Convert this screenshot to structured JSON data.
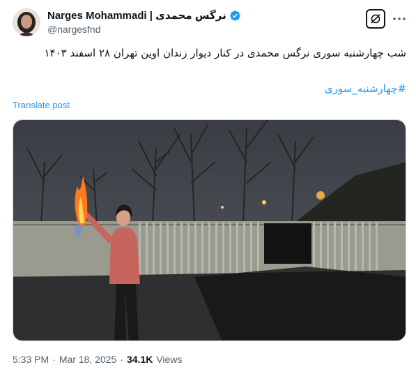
{
  "author": {
    "display_name": "Narges Mohammadi | نرگس محمدی",
    "handle": "@nargesfnd",
    "verified": true,
    "verified_color": "#1d9bf0"
  },
  "post": {
    "text": "شب چهارشنبه سوری نرگس محمدی در کنار دیوار زندان اوین تهران ۲۸ اسفند ۱۴۰۳",
    "hashtag": "#چهارشنبه_سوری",
    "translate_label": "Translate post"
  },
  "media": {
    "description_icon": "video-still"
  },
  "meta": {
    "time": "5:33 PM",
    "separator": "·",
    "date": "Mar 18, 2025",
    "views_count": "34.1K",
    "views_label": "Views"
  },
  "icons": {
    "grok": "grok-icon",
    "more": "more-icon",
    "verified": "verified-badge-icon"
  },
  "colors": {
    "link": "#1d9bf0",
    "secondary_text": "#536471",
    "primary_text": "#0f1419"
  }
}
